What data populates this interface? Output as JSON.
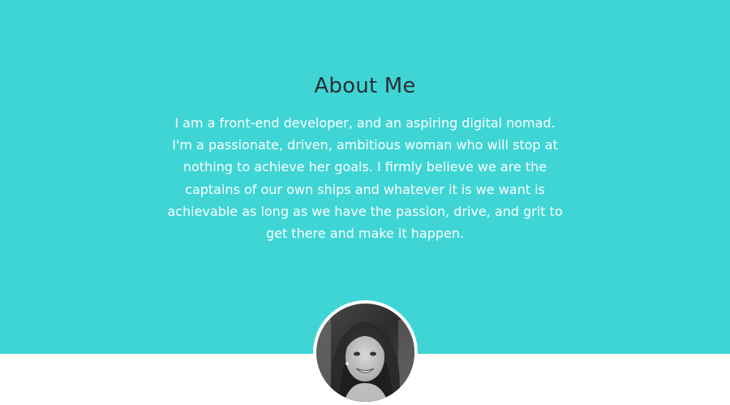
{
  "about": {
    "title": "About Me",
    "bio": "I am a front-end developer, and an aspiring digital nomad. I'm a passionate, driven, ambitious woman who will stop at nothing to achieve her goals. I firmly believe we are the captains of our own ships and whatever it is we want is achievable as long as we have the passion, drive, and grit to get there and make it happen."
  },
  "colors": {
    "accent_background": "#3fd5d5",
    "title_text": "#2a2f33",
    "body_text": "#ffffff",
    "lower_background": "#ffffff"
  },
  "avatar": {
    "icon": "profile-photo-icon"
  }
}
